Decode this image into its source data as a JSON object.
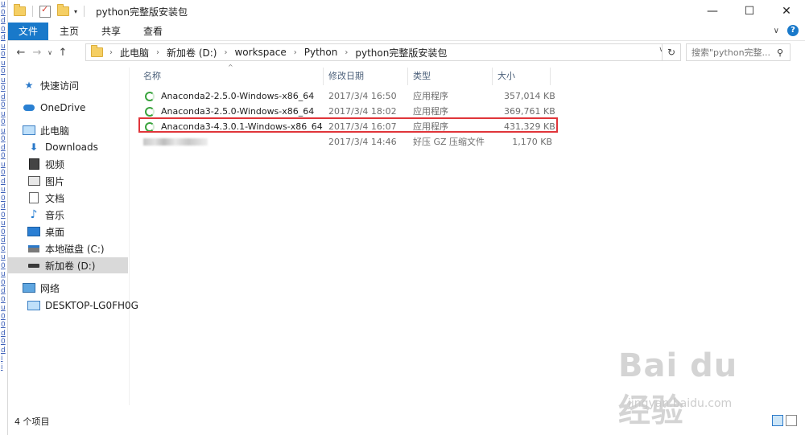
{
  "left_strip": {
    "glyphs": [
      "u",
      "0",
      "d",
      "0",
      "d",
      "u",
      "0",
      "u",
      "0",
      "u",
      "0",
      "d",
      "0",
      "u",
      "0",
      "u",
      "0",
      "d",
      "0",
      "u",
      "0",
      "d",
      "u",
      "0",
      "d",
      "0",
      "u",
      "0",
      "d",
      "0",
      "u",
      "0",
      "u",
      "0",
      "d",
      "0",
      "u",
      "0",
      "0",
      "d",
      "0",
      "d",
      "i",
      "i"
    ]
  },
  "window": {
    "title": "python完整版安装包",
    "controls": {
      "minimize": "—",
      "maximize": "☐",
      "close": "✕"
    }
  },
  "ribbon": {
    "tabs": [
      "文件",
      "主页",
      "共享",
      "查看"
    ]
  },
  "address": {
    "breadcrumbs": [
      "此电脑",
      "新加卷 (D:)",
      "workspace",
      "Python",
      "python完整版安装包"
    ],
    "search_placeholder": "搜索\"python完整...",
    "up_arrow": "^"
  },
  "nav": {
    "items": [
      {
        "label": "快速访问",
        "icon": "star-icon"
      },
      {
        "label": "OneDrive",
        "icon": "cloud-icon"
      },
      {
        "label": "此电脑",
        "icon": "computer-icon"
      },
      {
        "label": "Downloads",
        "icon": "download-icon"
      },
      {
        "label": "视频",
        "icon": "video-icon"
      },
      {
        "label": "图片",
        "icon": "picture-icon"
      },
      {
        "label": "文档",
        "icon": "document-icon"
      },
      {
        "label": "音乐",
        "icon": "music-icon"
      },
      {
        "label": "桌面",
        "icon": "desktop-icon"
      },
      {
        "label": "本地磁盘 (C:)",
        "icon": "drive-c-icon"
      },
      {
        "label": "新加卷 (D:)",
        "icon": "drive-icon",
        "selected": true
      },
      {
        "label": "网络",
        "icon": "network-icon"
      },
      {
        "label": "DESKTOP-LG0FH0G",
        "icon": "computer-icon"
      }
    ]
  },
  "file_list": {
    "columns": [
      "名称",
      "修改日期",
      "类型",
      "大小"
    ],
    "rows": [
      {
        "name": "Anaconda2-2.5.0-Windows-x86_64",
        "date": "2017/3/4 16:50",
        "type": "应用程序",
        "size": "357,014 KB"
      },
      {
        "name": "Anaconda3-2.5.0-Windows-x86_64",
        "date": "2017/3/4 18:02",
        "type": "应用程序",
        "size": "369,761 KB"
      },
      {
        "name": "Anaconda3-4.3.0.1-Windows-x86_64",
        "date": "2017/3/4 16:07",
        "type": "应用程序",
        "size": "431,329 KB",
        "highlighted": true
      },
      {
        "name": "",
        "date": "2017/3/4 14:46",
        "type": "好压 GZ 压缩文件",
        "size": "1,170 KB",
        "blurred": true
      }
    ],
    "highlight_color": "#e0353a"
  },
  "status": {
    "count": "4 个项目"
  },
  "watermark": {
    "logo": "Bai du 经验",
    "url": "jingyan.baidu.com"
  },
  "colors": {
    "accent": "#1979ca",
    "selected_nav": "#d9d9d9",
    "header_text": "#4c607a"
  }
}
